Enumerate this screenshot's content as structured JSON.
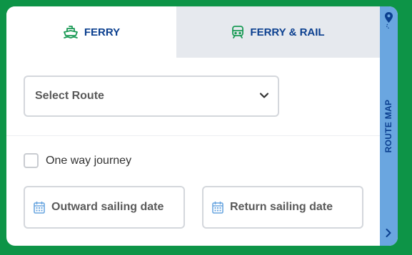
{
  "tabs": {
    "ferry": {
      "label": "FERRY",
      "icon": "ferry-icon",
      "active": true
    },
    "ferry_rail": {
      "label": "FERRY & RAIL",
      "icon": "train-icon",
      "active": false
    }
  },
  "route_select": {
    "label": "Select Route",
    "icon": "chevron-down-icon"
  },
  "one_way": {
    "label": "One way journey",
    "checked": false
  },
  "dates": {
    "outward": {
      "label": "Outward sailing date",
      "icon": "calendar-icon"
    },
    "return": {
      "label": "Return sailing date",
      "icon": "calendar-icon"
    }
  },
  "route_map": {
    "label": "ROUTE MAP",
    "icon": "map-pin-icon",
    "expand_icon": "chevron-right-icon"
  },
  "colors": {
    "background": "#0d9447",
    "tab_text": "#0b3f8f",
    "icon_green": "#1a9a55",
    "inactive_tab": "#e6e9ee",
    "route_map_panel": "#6aa6e0",
    "calendar_icon": "#6aa6e0"
  }
}
